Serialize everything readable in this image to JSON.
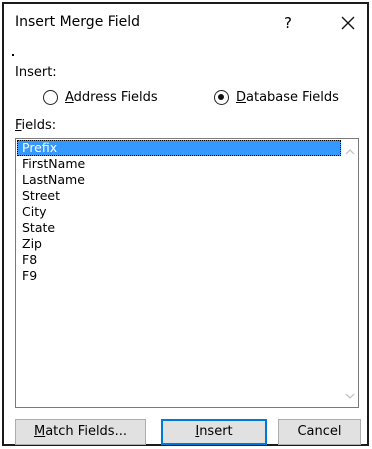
{
  "dialog": {
    "title": "Insert Merge Field",
    "help_label": "?",
    "close_icon": "close-icon"
  },
  "insert_section": {
    "label": "Insert:",
    "options": [
      {
        "label_mnemonic": "A",
        "label_rest": "ddress Fields",
        "selected": false
      },
      {
        "label_mnemonic": "D",
        "label_rest": "atabase Fields",
        "selected": true
      }
    ]
  },
  "fields_section": {
    "label_mnemonic": "F",
    "label_rest": "ields:",
    "items": [
      "Prefix",
      "FirstName",
      "LastName",
      "Street",
      "City",
      "State",
      "Zip",
      "F8",
      "F9"
    ],
    "selected_index": 0
  },
  "buttons": {
    "match_fields": {
      "mnemonic": "M",
      "rest": "atch Fields..."
    },
    "insert": {
      "mnemonic": "I",
      "rest": "nsert"
    },
    "cancel": {
      "label": "Cancel"
    }
  },
  "colors": {
    "selection": "#3399ff",
    "default_button_border": "#0078d7",
    "button_face": "#e1e1e1"
  }
}
